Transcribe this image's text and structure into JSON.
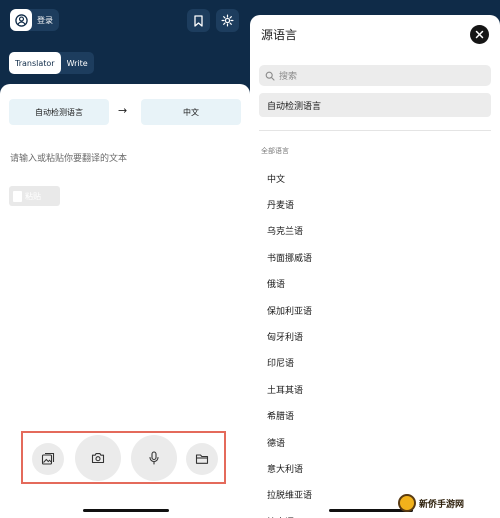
{
  "left": {
    "login_label": "登录",
    "tabs": [
      {
        "label": "Translator",
        "active": true
      },
      {
        "label": "Write",
        "active": false
      }
    ],
    "source_lang": "自动检测语言",
    "swap_glyph": "→",
    "target_lang": "中文",
    "input_placeholder": "请输入或粘贴你要翻译的文本",
    "paste_label": "粘贴",
    "actions": [
      "image-icon",
      "camera-icon",
      "microphone-icon",
      "folder-icon"
    ]
  },
  "right": {
    "title": "源语言",
    "search_placeholder": "搜索",
    "auto_detect": "自动检测语言",
    "section_label": "全部语言",
    "languages": [
      "中文",
      "丹麦语",
      "乌克兰语",
      "书面挪威语",
      "俄语",
      "保加利亚语",
      "匈牙利语",
      "印尼语",
      "土耳其语",
      "希腊语",
      "德语",
      "意大利语",
      "拉脱维亚语",
      "捷克语"
    ]
  },
  "watermark": {
    "text": "新侨手游网"
  },
  "colors": {
    "navy": "#0f2b48",
    "light_blue": "#e8f3f8",
    "highlight": "#e46a5b"
  }
}
